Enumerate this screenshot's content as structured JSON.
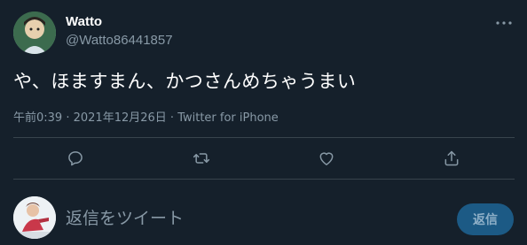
{
  "tweet": {
    "display_name": "Watto",
    "handle": "@Watto86441857",
    "text": "や、ほますまん、かつさんめちゃうまい",
    "time": "午前0:39",
    "separator1": " · ",
    "date": "2021年12月26日",
    "separator2": " · ",
    "source": "Twitter for iPhone"
  },
  "actions": {
    "reply_icon": "reply-icon",
    "retweet_icon": "retweet-icon",
    "like_icon": "heart-icon",
    "share_icon": "share-icon"
  },
  "reply_box": {
    "placeholder": "返信をツイート",
    "button_label": "返信"
  },
  "colors": {
    "background": "#15202b",
    "secondary_text": "#8899a6",
    "divider": "#38444d",
    "reply_button_bg": "#1c5a85"
  }
}
